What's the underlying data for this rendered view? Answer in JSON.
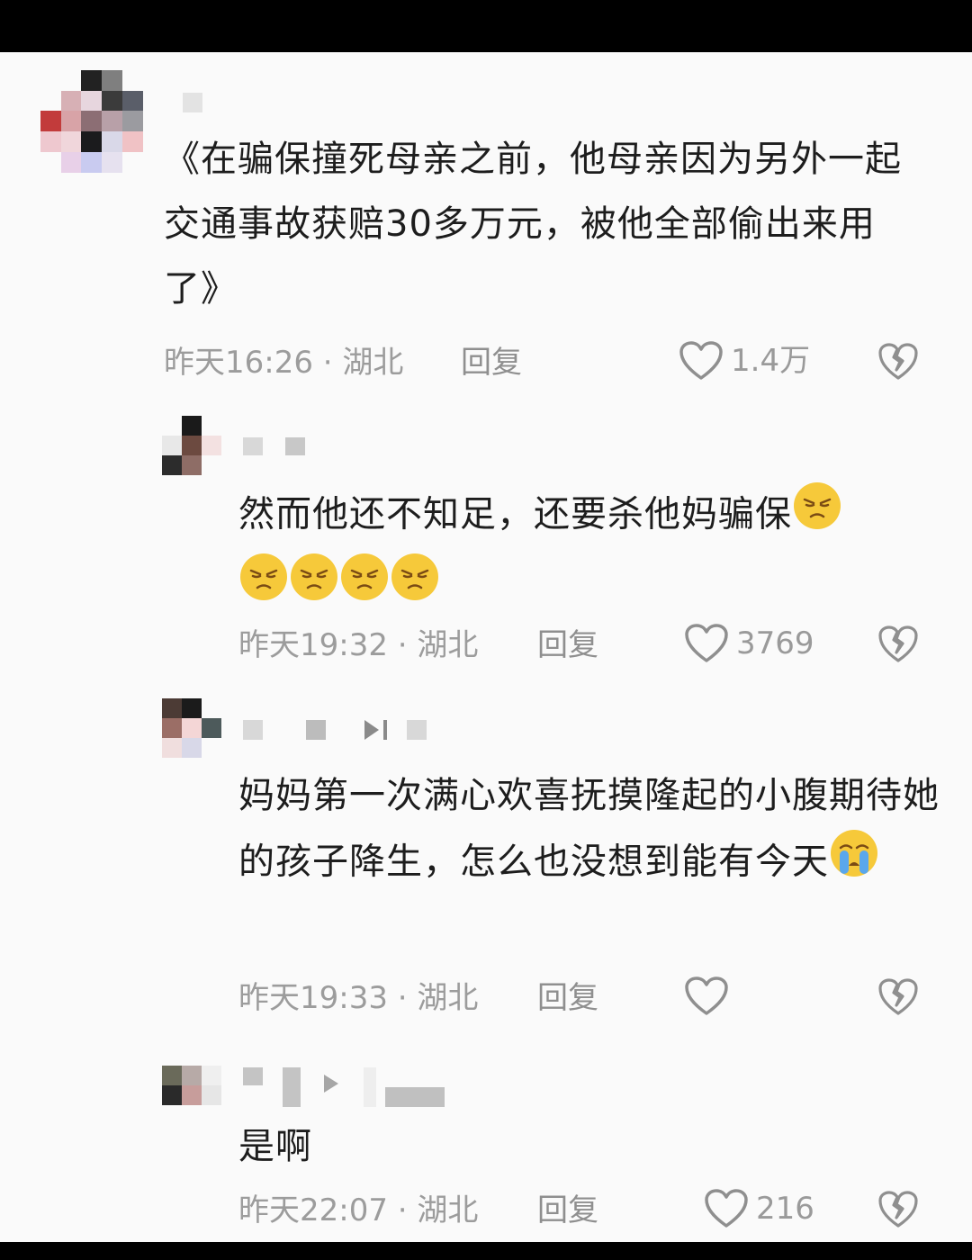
{
  "comments": [
    {
      "text": "《在骗保撞死母亲之前，他母亲因为另外一起交通事故获赔30多万元，被他全部偷出来用了》",
      "meta": "昨天16:26 · 湖北",
      "reply": "回复",
      "likes": "1.4万"
    },
    {
      "text": "然而他还不知足，还要杀他妈骗保",
      "emoji": "angry-face",
      "meta": "昨天19:32 · 湖北",
      "reply": "回复",
      "likes": "3769"
    },
    {
      "text": "妈妈第一次满心欢喜抚摸隆起的小腹期待她的孩子降生，怎么也没想到能有今天",
      "emoji": "crying-face",
      "meta": "昨天19:33 · 湖北",
      "reply": "回复",
      "likes": ""
    },
    {
      "text": "是啊",
      "meta": "昨天22:07 · 湖北",
      "reply": "回复",
      "likes": "216"
    }
  ],
  "colors": {
    "background": "#fafafa",
    "text": "#1d1d1d",
    "meta": "#9c9c9c",
    "emoji_yellow": "#f6c93a"
  },
  "icons": [
    "heart-outline-icon",
    "broken-heart-icon",
    "angry-emoji-icon",
    "crying-emoji-icon"
  ]
}
